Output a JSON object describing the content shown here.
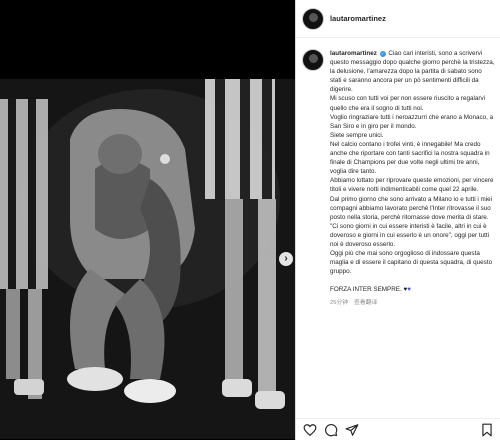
{
  "post": {
    "username": "lautaromartinez",
    "caption_lines": [
      "Ciao cari interisti, sono a scrivervi questo messaggio dopo qualche giorno perchè la tristezza, la delusione, l'amarezza dopo la partita di sabato sono stati e saranno ancora per un pò sentimenti difficili da digerire.",
      "Mi scuso con tutti voi per non essere riuscito a regalarvi quello che era il sogno di tutti noi.",
      "Voglio ringraziare tutti i neroazzurri che erano a Monaco, a San Siro e in giro per il mondo.",
      "Siete sempre unici.",
      "Nel calcio contano i trofei vinti, è innegabile! Ma credo anche che riportare con tanti sacrifici la nostra squadra in finale di Champions per due volte negli ultimi tre anni, voglia dire tanto.",
      "Abbiamo lottato per riprovare queste emozioni, per vincere titoli e vivere notti indimenticabili come quel 22 aprile.",
      "Dal primo giorno che sono arrivato a Milano io e tutti i miei compagni abbiamo lavorato perchè l'Inter ritrovasse il suo posto nella storia, perchè ritornasse dove merita di stare.",
      "\"Ci sono giorni in cui essere interisti è facile, altri in cui è doveroso e giorni in cui esserlo è un onore\", oggi per tutti noi è doveroso esserlo.",
      "Oggi più che mai sono orgoglioso di indossare questa maglia e di essere il capitano di questa squadra, di questo gruppo."
    ],
    "closing": "FORZA INTER SEMPRE.",
    "hearts": [
      "♥",
      "♥"
    ],
    "timestamp": "25分钟",
    "timestamp_link": "查看翻译"
  },
  "icons": {
    "verified": "verified-badge-icon",
    "next": "chevron-right-icon",
    "like": "heart-icon",
    "comment": "comment-icon",
    "share": "paper-plane-icon",
    "save": "bookmark-icon"
  },
  "colors": {
    "verified": "#3897f0",
    "heart_blue": "#3b5bdb",
    "text": "#262626",
    "muted": "#8e8e8e"
  }
}
